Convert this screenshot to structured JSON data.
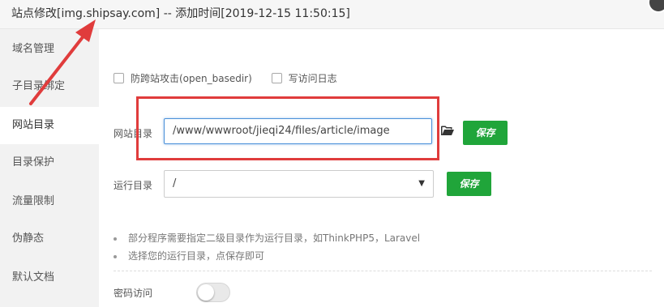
{
  "window": {
    "title": "站点修改[img.shipsay.com] -- 添加时间[2019-12-15 11:50:15]"
  },
  "sidebar": {
    "items": [
      {
        "label": "域名管理"
      },
      {
        "label": "子目录绑定"
      },
      {
        "label": "网站目录"
      },
      {
        "label": "目录保护"
      },
      {
        "label": "流量限制"
      },
      {
        "label": "伪静态"
      },
      {
        "label": "默认文档"
      }
    ],
    "active_item": "网站目录"
  },
  "options": {
    "open_basedir_label": "防跨站攻击(open_basedir)",
    "open_basedir_checked": false,
    "access_log_label": "写访问日志",
    "access_log_checked": false
  },
  "site_dir": {
    "label": "网站目录",
    "value": "/www/wwwroot/jieqi24/files/article/image",
    "folder_icon": "folder-open-icon",
    "save_label": "保存"
  },
  "run_dir": {
    "label": "运行目录",
    "selected": "/",
    "save_label": "保存"
  },
  "tips": [
    "部分程序需要指定二级目录作为运行目录，如ThinkPHP5，Laravel",
    "选择您的运行目录，点保存即可"
  ],
  "password_access": {
    "label": "密码访问",
    "enabled": false
  },
  "colors": {
    "save_button": "#20a53a",
    "annotation": "#e03c3c",
    "sidebar_bg": "#f2f2f2"
  }
}
